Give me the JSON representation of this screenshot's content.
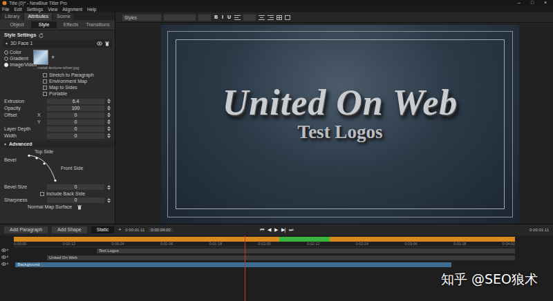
{
  "window": {
    "title": "Title (0)* - NewBlue Titler Pro",
    "controls": [
      "–",
      "□",
      "×"
    ]
  },
  "menu": [
    "File",
    "Edit",
    "Settings",
    "View",
    "Alignment",
    "Help"
  ],
  "panel_tabs": [
    {
      "label": "Library",
      "selected": false
    },
    {
      "label": "Attributes",
      "selected": true
    },
    {
      "label": "Scene",
      "selected": false
    }
  ],
  "attribute_tabs": [
    {
      "label": "Object",
      "selected": false
    },
    {
      "label": "Style",
      "selected": true
    },
    {
      "label": "Effects",
      "selected": false
    },
    {
      "label": "Transitions",
      "selected": false
    }
  ],
  "style_settings": {
    "title": "Style Settings",
    "layer": "3D Face 1",
    "add": "+",
    "image_file": "…metal-texture-silver.jpg",
    "fill_types": [
      {
        "label": "Color",
        "selected": false
      },
      {
        "label": "Gradient",
        "selected": false
      },
      {
        "label": "Image/Video",
        "selected": true
      }
    ],
    "options": [
      {
        "label": "Stretch to Paragraph",
        "checked": false
      },
      {
        "label": "Environment Map",
        "checked": false
      },
      {
        "label": "Map to Sides",
        "checked": false
      },
      {
        "label": "Portable",
        "checked": false
      }
    ],
    "properties": [
      {
        "label": "Extrusion",
        "sub": "",
        "value": "6.4"
      },
      {
        "label": "Opacity",
        "sub": "",
        "value": "100"
      },
      {
        "label": "Offset",
        "sub": "X",
        "value": "0"
      },
      {
        "label": "",
        "sub": "Y",
        "value": "0"
      },
      {
        "label": "Layer Depth",
        "sub": "",
        "value": "0"
      },
      {
        "label": "Width",
        "sub": "",
        "value": "0"
      }
    ],
    "advanced": {
      "label": "Advanced",
      "expanded": true,
      "bevel": "Bevel",
      "top_side": "Top Side",
      "front_side": "Front Side",
      "bevel_size": {
        "label": "Bevel Size",
        "value": "0"
      },
      "include_back_side": {
        "label": "Include Back Side",
        "checked": false
      },
      "sharpness": {
        "label": "Sharpness",
        "value": "0"
      },
      "normal_map": "Normal Map Surface"
    }
  },
  "toolbar": {
    "style_field": "Styles",
    "format": [
      "B",
      "I",
      "U"
    ]
  },
  "canvas": {
    "title": "United On Web",
    "subtitle": "Test Logos"
  },
  "controls": {
    "buttons": [
      "Add Paragraph",
      "Add Shape"
    ],
    "mode": "Static",
    "add": "+",
    "time_in": "0:00:01:11",
    "time_out": "0:00:04:00",
    "transport": [
      "⏮",
      "◀",
      "▶",
      "▶|",
      "⏭"
    ],
    "timecode": "0:00:01:11"
  },
  "timeline": {
    "ruler": [
      "0:00:00",
      "0:00:12",
      "0:00:24",
      "0:01:06",
      "0:01:18",
      "0:02:00",
      "0:02:12",
      "0:02:24",
      "0:03:06",
      "0:03:18",
      "0:04:00"
    ],
    "playhead": {
      "level": 0.46
    },
    "tracks": [
      {
        "name": "Text Logos",
        "visible": true
      },
      {
        "name": "United On Web",
        "visible": true
      },
      {
        "name": "Background",
        "visible": true
      }
    ]
  },
  "watermark": "知乎 @SEO狼术"
}
